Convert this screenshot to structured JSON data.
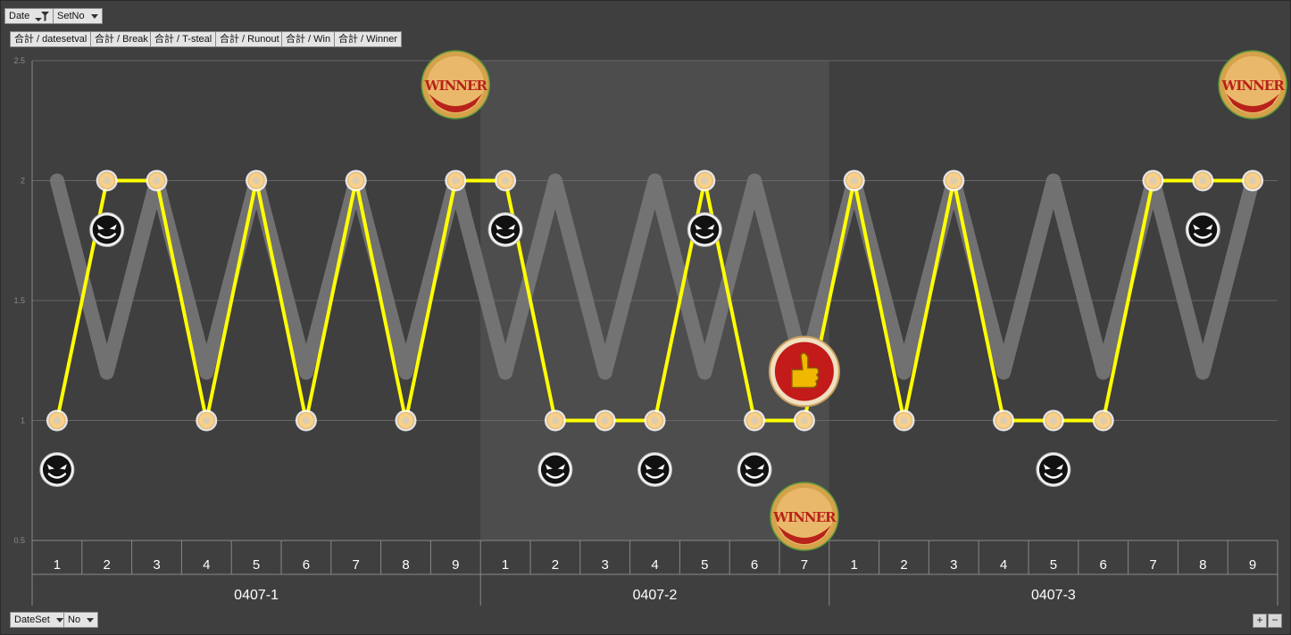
{
  "filters": {
    "date_label": "Date",
    "setno_label": "SetNo"
  },
  "value_buttons": [
    "合計 / datesetval",
    "合計 / Break",
    "合計 / T-steal",
    "合計 / Runout",
    "合計 / Win",
    "合計 / Winner"
  ],
  "row_fields": {
    "dateset_label": "DateSet",
    "no_label": "No"
  },
  "zoom": {
    "plus": "+",
    "minus": "−"
  },
  "colors": {
    "background": "#3f3f3f",
    "highlight_band": "#4d4d4d",
    "main_line": "#ffff00",
    "gray_line": "#7a7a7a",
    "marker_fill": "#f7d08a",
    "gridline": "#666666"
  },
  "icons": {
    "break_marker": "angry-face-icon",
    "winner_marker": "winner-medal-icon",
    "runout_marker": "thumbs-up-icon"
  },
  "chart_data": {
    "type": "line",
    "ylim": [
      0.5,
      2.5
    ],
    "yticks": [
      "0.5",
      "1",
      "1.5",
      "2",
      "2.5"
    ],
    "grid": true,
    "highlighted_group": "0407-2",
    "groups": [
      {
        "name": "0407-1",
        "nos": [
          "1",
          "2",
          "3",
          "4",
          "5",
          "6",
          "7",
          "8",
          "9"
        ]
      },
      {
        "name": "0407-2",
        "nos": [
          "1",
          "2",
          "3",
          "4",
          "5",
          "6",
          "7"
        ]
      },
      {
        "name": "0407-3",
        "nos": [
          "1",
          "2",
          "3",
          "4",
          "5",
          "6",
          "7",
          "8",
          "9"
        ]
      }
    ],
    "series": [
      {
        "values": [
          1,
          2,
          2,
          1,
          2,
          1,
          2,
          1,
          2,
          2,
          1,
          1,
          1,
          2,
          1,
          1,
          2,
          1,
          2,
          1,
          1,
          1,
          2,
          2,
          2
        ]
      },
      {
        "values": [
          2,
          1,
          2,
          1,
          2,
          1,
          2,
          1,
          2,
          1,
          2,
          1,
          2,
          1,
          2,
          1,
          2,
          1,
          2,
          1,
          2,
          1,
          2,
          1,
          2
        ]
      }
    ],
    "break_positions": [
      0,
      1,
      9,
      10,
      12,
      13,
      14,
      20,
      23
    ],
    "winner_positions": [
      8,
      15,
      24
    ],
    "runout_positions": [
      15
    ]
  }
}
